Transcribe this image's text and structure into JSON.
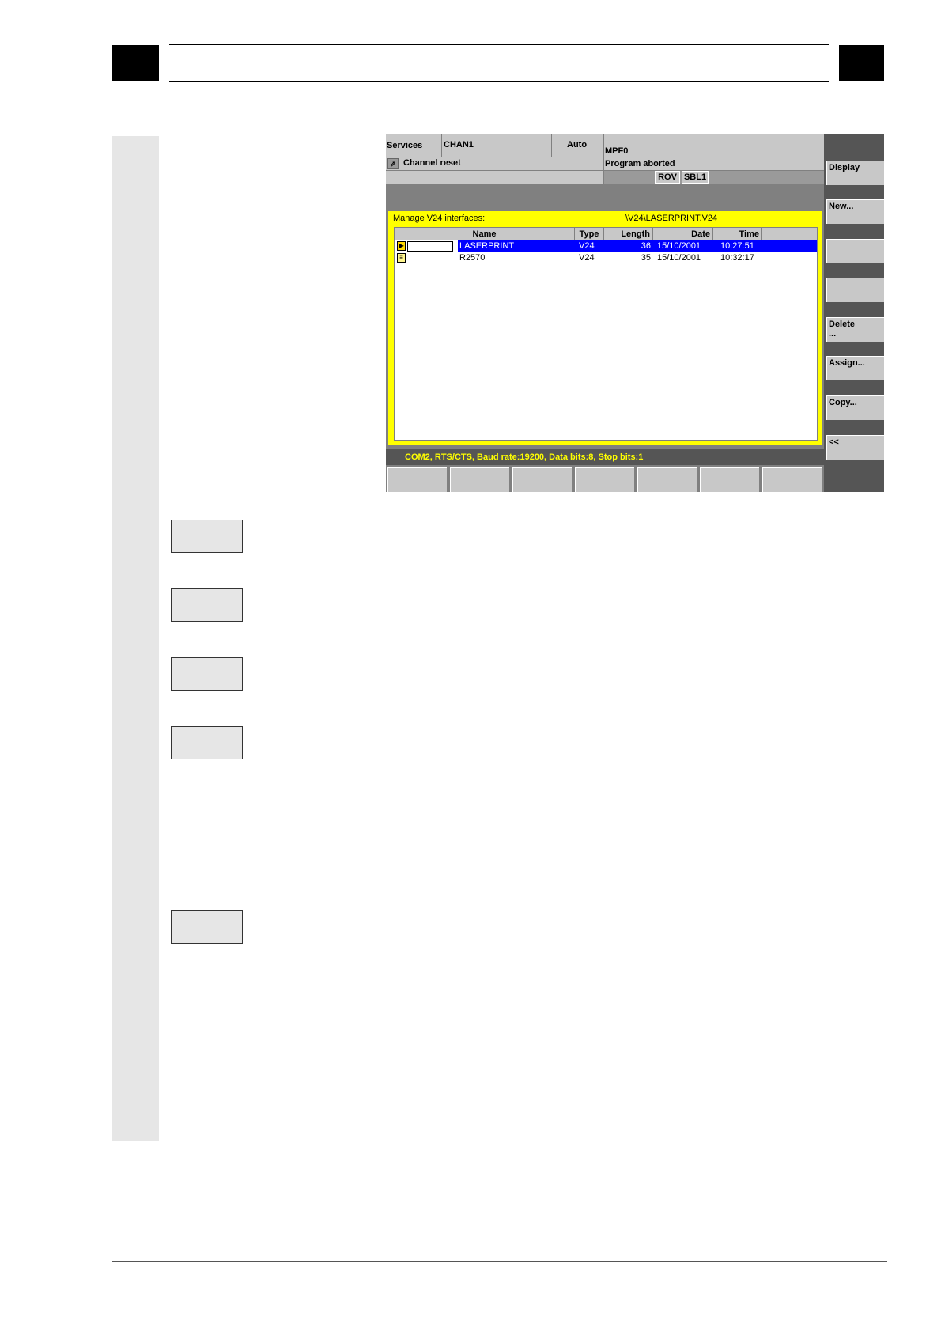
{
  "screen": {
    "header": {
      "area": "Services",
      "channel": "CHAN1",
      "mode": "Auto",
      "program": "MPF0",
      "channel_status": "Channel reset",
      "program_status": "Program aborted",
      "indicators": [
        "ROV",
        "SBL1"
      ]
    },
    "window": {
      "title": "Manage V24 interfaces:",
      "path": "\\V24\\LASERPRINT.V24",
      "columns": [
        "Name",
        "Type",
        "Length",
        "Date",
        "Time"
      ],
      "rows": [
        {
          "name": "LASERPRINT",
          "type": "V24",
          "length": "36",
          "date": "15/10/2001",
          "time": "10:27:51",
          "selected": true
        },
        {
          "name": "R2570",
          "type": "V24",
          "length": "35",
          "date": "15/10/2001",
          "time": "10:32:17",
          "selected": false
        }
      ]
    },
    "status_line": "COM2, RTS/CTS, Baud rate:19200, Data bits:8, Stop bits:1",
    "vertical_softkeys": [
      "Display",
      "New...",
      "",
      "",
      "Delete\n...",
      "Assign...",
      "Copy...",
      "<<"
    ]
  }
}
